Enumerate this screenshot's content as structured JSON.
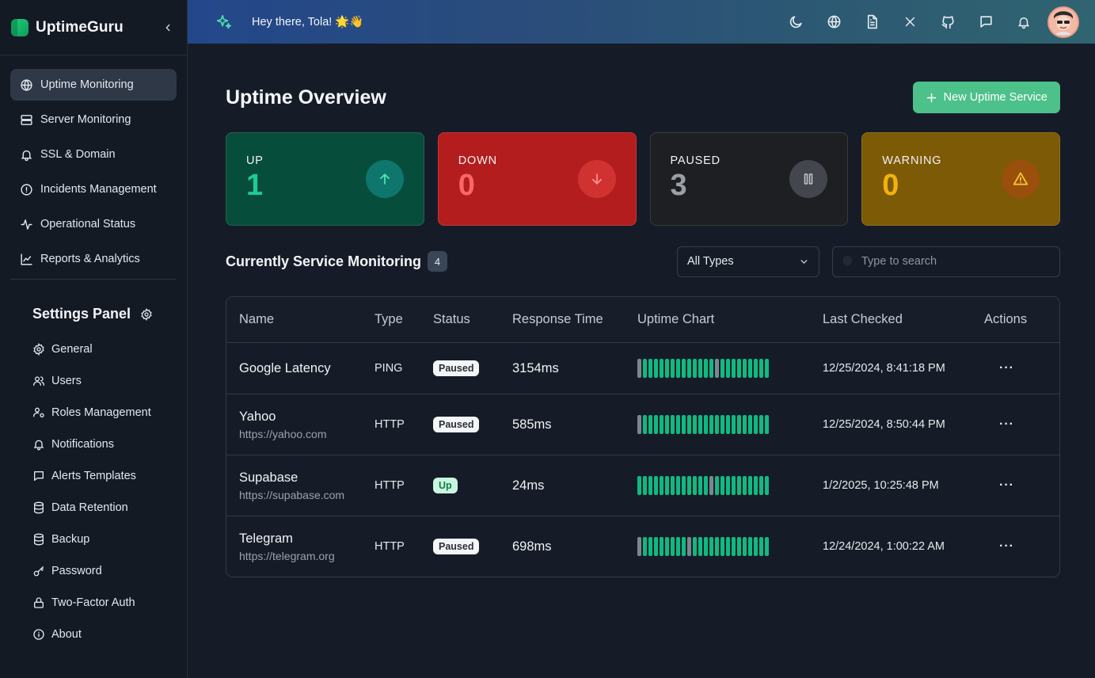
{
  "app": {
    "name": "UptimeGuru"
  },
  "sidebar": {
    "items": [
      {
        "label": "Uptime Monitoring",
        "icon": "globe-icon",
        "active": true
      },
      {
        "label": "Server Monitoring",
        "icon": "server-icon"
      },
      {
        "label": "SSL & Domain",
        "icon": "bell-icon"
      },
      {
        "label": "Incidents Management",
        "icon": "info-circle-icon"
      },
      {
        "label": "Operational Status",
        "icon": "activity-icon"
      },
      {
        "label": "Reports & Analytics",
        "icon": "line-chart-icon"
      }
    ],
    "settings_title": "Settings Panel",
    "settings": [
      {
        "label": "General",
        "icon": "gear-icon"
      },
      {
        "label": "Users",
        "icon": "users-icon"
      },
      {
        "label": "Roles Management",
        "icon": "user-cog-icon"
      },
      {
        "label": "Notifications",
        "icon": "bell-icon"
      },
      {
        "label": "Alerts Templates",
        "icon": "message-icon"
      },
      {
        "label": "Data Retention",
        "icon": "database-icon"
      },
      {
        "label": "Backup",
        "icon": "database-icon"
      },
      {
        "label": "Password",
        "icon": "key-icon"
      },
      {
        "label": "Two-Factor Auth",
        "icon": "lock-icon"
      },
      {
        "label": "About",
        "icon": "info-circle-icon"
      }
    ]
  },
  "topbar": {
    "greeting": "Hey there, Tola! 🌟👋",
    "icons": [
      "moon-icon",
      "globe-icon",
      "document-icon",
      "x-icon",
      "github-icon",
      "chat-icon",
      "bell-icon"
    ]
  },
  "page": {
    "title": "Uptime Overview",
    "new_button": "New Uptime Service"
  },
  "stats": [
    {
      "label": "UP",
      "value": "1",
      "icon": "arrow-up-icon"
    },
    {
      "label": "DOWN",
      "value": "0",
      "icon": "arrow-down-icon"
    },
    {
      "label": "PAUSED",
      "value": "3",
      "icon": "pause-icon"
    },
    {
      "label": "WARNING",
      "value": "0",
      "icon": "warning-icon"
    }
  ],
  "section": {
    "title": "Currently Service Monitoring",
    "count": "4",
    "filter_value": "All Types",
    "search_placeholder": "Type to search"
  },
  "table": {
    "headers": [
      "Name",
      "Type",
      "Status",
      "Response Time",
      "Uptime Chart",
      "Last Checked",
      "Actions"
    ],
    "rows": [
      {
        "name": "Google Latency",
        "url": "",
        "type": "PING",
        "status": "Paused",
        "response": "3154ms",
        "last": "12/25/2024, 8:41:18 PM",
        "gray_bars": [
          0,
          14
        ]
      },
      {
        "name": "Yahoo",
        "url": "https://yahoo.com",
        "type": "HTTP",
        "status": "Paused",
        "response": "585ms",
        "last": "12/25/2024, 8:50:44 PM",
        "gray_bars": [
          0
        ]
      },
      {
        "name": "Supabase",
        "url": "https://supabase.com",
        "type": "HTTP",
        "status": "Up",
        "response": "24ms",
        "last": "1/2/2025, 10:25:48 PM",
        "gray_bars": [
          13
        ]
      },
      {
        "name": "Telegram",
        "url": "https://telegram.org",
        "type": "HTTP",
        "status": "Paused",
        "response": "698ms",
        "last": "12/24/2024, 1:00:22 AM",
        "gray_bars": [
          0,
          9
        ]
      }
    ],
    "bar_count": 24,
    "action_label": "···"
  },
  "colors": {
    "accent": "#4cc18a",
    "up": "#10b981",
    "down": "#b41d1d",
    "warning": "#7d5a05",
    "uptime_bar": "#10b981",
    "uptime_bar_gap": "#7e8591"
  }
}
